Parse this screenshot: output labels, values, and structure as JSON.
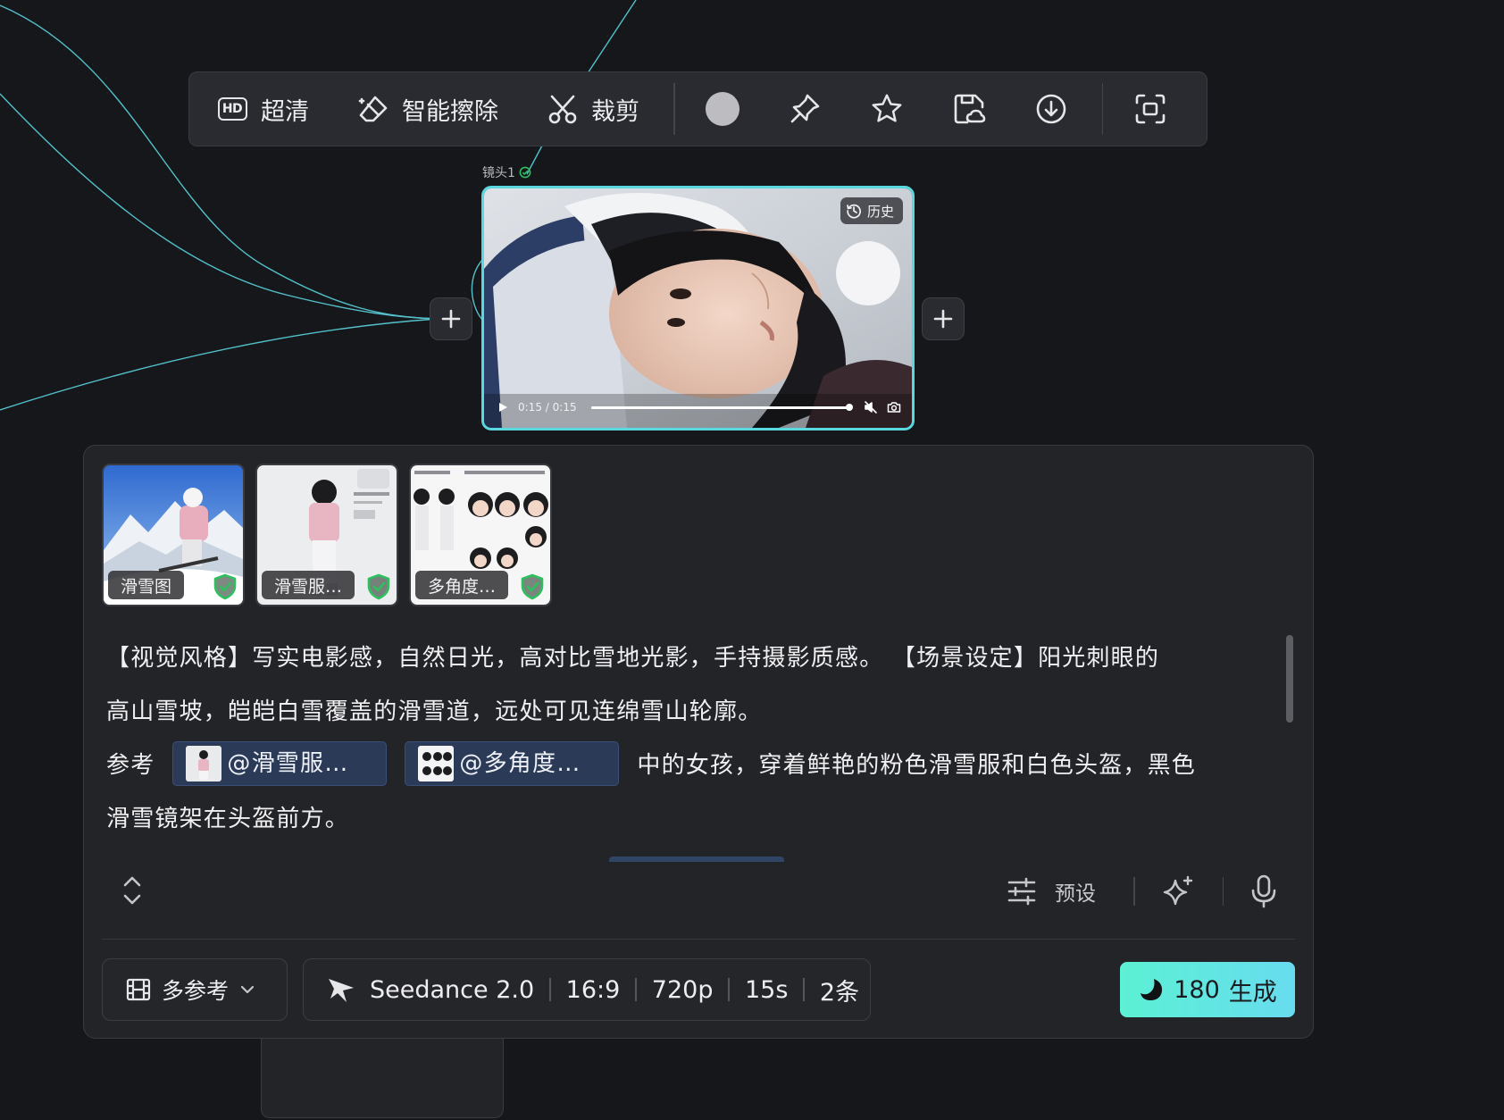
{
  "toolbar": {
    "hd_badge": "HD",
    "hd_label": "超清",
    "erase_label": "智能擦除",
    "crop_label": "裁剪"
  },
  "shot": {
    "label": "镜头1",
    "history_label": "历史",
    "time_current": "0:15",
    "time_separator": "/",
    "time_total": "0:15",
    "progress": 1.0
  },
  "references": [
    {
      "label": "滑雪图"
    },
    {
      "label": "滑雪服…"
    },
    {
      "label": "多角度…"
    }
  ],
  "prompt": {
    "line1": "【视觉风格】写实电影感，自然日光，高对比雪地光影，手持摄影质感。 【场景设定】阳光刺眼的",
    "line2": "高山雪坡，皑皑白雪覆盖的滑雪道，远处可见连绵雪山轮廓。",
    "line3_prefix": "参考",
    "chip1": "@滑雪服…",
    "chip2": "@多角度…",
    "line3_suffix": "中的女孩，穿着鲜艳的粉色滑雪服和白色头盔，黑色",
    "line4": "滑雪镜架在头盔前方。"
  },
  "tools": {
    "preset_label": "预设"
  },
  "bottom": {
    "mode_label": "多参考",
    "model_name": "Seedance 2.0",
    "ratio": "16:9",
    "resolution": "720p",
    "duration": "15s",
    "count": "2条",
    "generate_cost": "180",
    "generate_label": "生成"
  },
  "colors": {
    "accent": "#5ad8e0",
    "generate_gradient_start": "#5cf0d4",
    "generate_gradient_end": "#68dcef",
    "shield_green": "#2fbf5f",
    "chip_bg": "#2b3a56"
  }
}
